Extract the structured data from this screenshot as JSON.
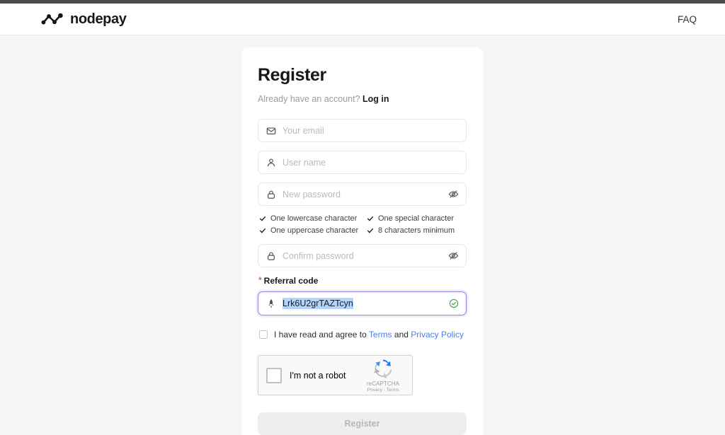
{
  "header": {
    "brand_name": "nodepay",
    "brand_logo_icon": "nodepay-zigzag-logo",
    "faq_label": "FAQ"
  },
  "form": {
    "title": "Register",
    "subline_prefix": "Already have an account?",
    "login_label": "Log in",
    "fields": [
      {
        "icon": "envelope-icon",
        "placeholder": "Your email",
        "value": "",
        "trailing": "none"
      },
      {
        "icon": "user-icon",
        "placeholder": "User name",
        "value": "",
        "trailing": "eye-off-icon"
      },
      {
        "icon": "lock-icon",
        "placeholder": "New password",
        "value": "",
        "trailing": "eye-off-icon"
      },
      {
        "icon": "lock-icon",
        "placeholder": "Confirm password",
        "value": "",
        "trailing": "eye-off-icon"
      }
    ],
    "password_requirements": [
      "One lowercase character",
      "One special character",
      "One uppercase character",
      "8 characters minimum"
    ],
    "referral": {
      "required_marker": "*",
      "label": "Referral code",
      "icon": "rocket-icon",
      "value": "Lrk6U2grTAZTcyn",
      "status_icon": "check-circle-icon",
      "focused": true,
      "text_selected": true
    },
    "agreement": {
      "prefix": "I have read and agree to",
      "terms_label": "Terms",
      "conjunction": "and",
      "privacy_label": "Privacy Policy",
      "checked": false
    },
    "recaptcha": {
      "label": "I'm not a robot",
      "brand": "reCAPTCHA",
      "legal": "Privacy - Terms",
      "logo_icon": "recaptcha-logo-icon",
      "checked": false
    },
    "submit_label": "Register",
    "submit_disabled": true
  },
  "colors": {
    "page_background": "#f5f5f6",
    "card_background": "#ffffff",
    "accent_focus": "#8b87e8",
    "link_blue": "#4a7ef0",
    "success_green": "#4fa24f",
    "required_red": "#f15b50",
    "selection_blue": "#b4d5fb",
    "topbar_dark": "#4a4a4a"
  }
}
